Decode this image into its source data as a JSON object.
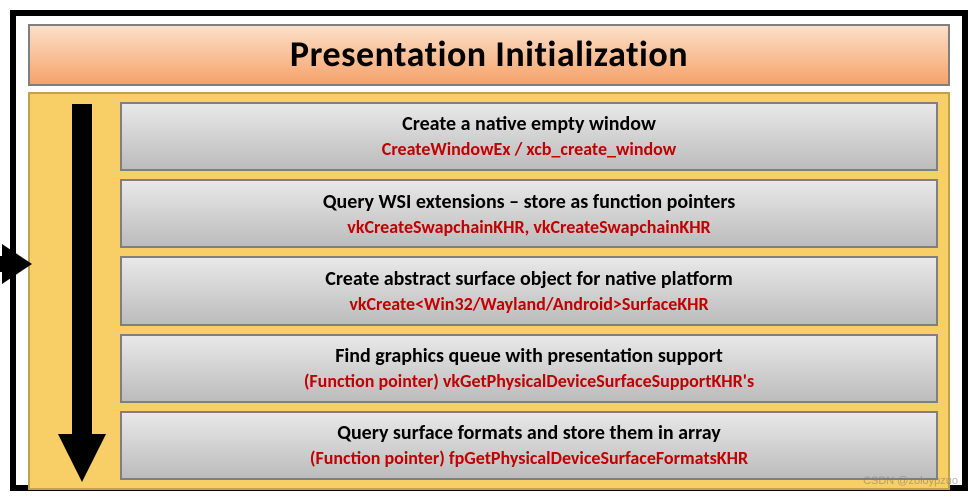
{
  "title": "Presentation Initialization",
  "steps": [
    {
      "title": "Create a native empty window",
      "api": "CreateWindowEx / xcb_create_window"
    },
    {
      "title": "Query WSI extensions – store as function pointers",
      "api": "vkCreateSwapchainKHR, vkCreateSwapchainKHR"
    },
    {
      "title": "Create abstract surface object for native platform",
      "api": "vkCreate<Win32/Wayland/Android>SurfaceKHR"
    },
    {
      "title": "Find graphics queue with presentation support",
      "api": "(Function pointer) vkGetPhysicalDeviceSurfaceSupportKHR's"
    },
    {
      "title": "Query surface formats and store them in array",
      "api": "(Function pointer) fpGetPhysicalDeviceSurfaceFormatsKHR"
    }
  ],
  "watermark": "CSDN @zoloypzuo"
}
